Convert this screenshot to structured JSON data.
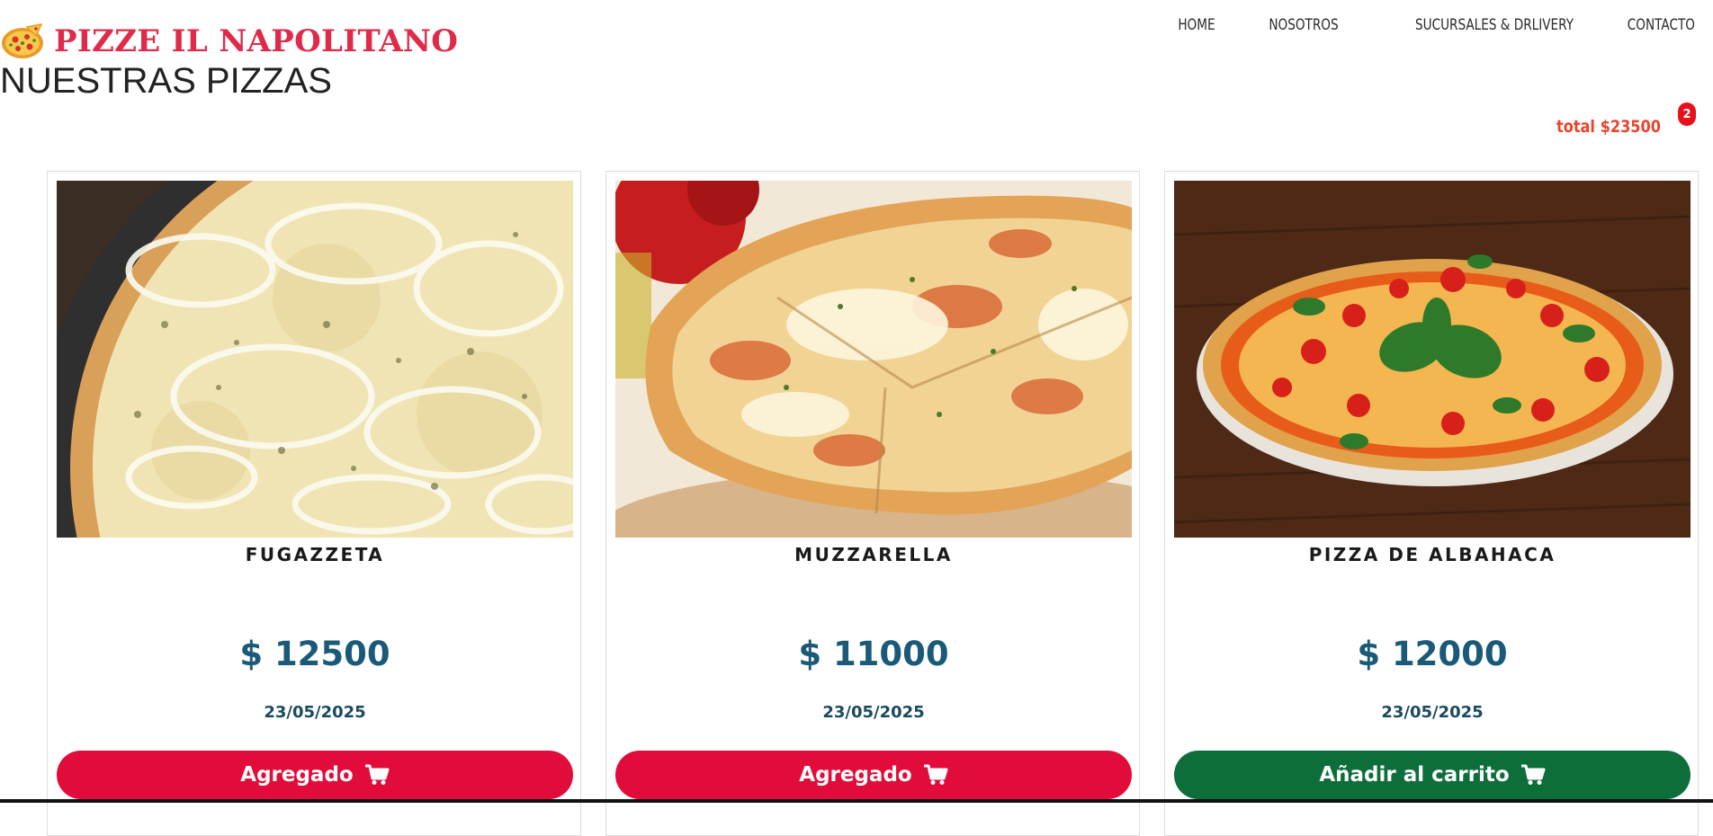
{
  "brand": {
    "name": "PIZZE IL NAPOLITANO",
    "logo_icon": "pizza-icon",
    "color": "#e02a4a"
  },
  "nav": {
    "items": [
      {
        "label": "HOME"
      },
      {
        "label": "NOSOTROS"
      },
      {
        "label": "SUCURSALES & DRLIVERY"
      },
      {
        "label": "CONTACTO"
      }
    ]
  },
  "page": {
    "title": "NUESTRAS PIZZAS"
  },
  "cart": {
    "total": "total $23500",
    "count": "2",
    "badge_color": "#e8101a"
  },
  "products": [
    {
      "name": "FUGAZZETA",
      "price": "$ 12500",
      "date": "23/05/2025",
      "button": "Agregado",
      "button_state": "added",
      "button_icon": "cart-icon"
    },
    {
      "name": "MUZZARELLA",
      "price": "$ 11000",
      "date": "23/05/2025",
      "button": "Agregado",
      "button_state": "added",
      "button_icon": "cart-icon"
    },
    {
      "name": "PIZZA DE ALBAHACA",
      "price": "$ 12000",
      "date": "23/05/2025",
      "button": "Añadir al carrito",
      "button_state": "add",
      "button_icon": "cart-icon"
    }
  ],
  "colors": {
    "added_button": "#e20c3a",
    "add_button": "#0e6e3a",
    "price_text": "#1a5a78"
  }
}
